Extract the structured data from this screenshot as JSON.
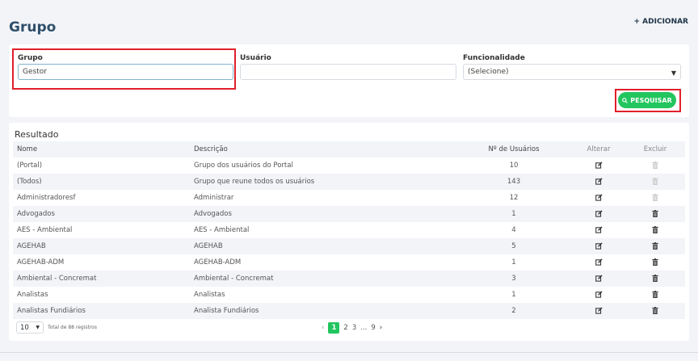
{
  "page": {
    "title": "Grupo",
    "add_label": "+ ADICIONAR"
  },
  "filters": {
    "grupo_label": "Grupo",
    "grupo_value": "Gestor",
    "usuario_label": "Usuário",
    "usuario_value": "",
    "funcionalidade_label": "Funcionalidade",
    "funcionalidade_value": "(Selecione)",
    "search_label": "PESQUISAR"
  },
  "result": {
    "title": "Resultado",
    "headers": {
      "nome": "Nome",
      "descricao": "Descrição",
      "usuarios": "Nº de Usuários",
      "alterar": "Alterar",
      "excluir": "Excluir"
    },
    "rows": [
      {
        "nome": "(Portal)",
        "descricao": "Grupo dos usuários do Portal",
        "usuarios": "10",
        "deletable": false
      },
      {
        "nome": "(Todos)",
        "descricao": "Grupo que reune todos os usuários",
        "usuarios": "143",
        "deletable": false
      },
      {
        "nome": "Administradoresf",
        "descricao": "Administrar",
        "usuarios": "12",
        "deletable": false
      },
      {
        "nome": "Advogados",
        "descricao": "Advogados",
        "usuarios": "1",
        "deletable": true
      },
      {
        "nome": "AES - Ambiental",
        "descricao": "AES - Ambiental",
        "usuarios": "4",
        "deletable": true
      },
      {
        "nome": "AGEHAB",
        "descricao": "AGEHAB",
        "usuarios": "5",
        "deletable": true
      },
      {
        "nome": "AGEHAB-ADM",
        "descricao": "AGEHAB-ADM",
        "usuarios": "1",
        "deletable": true
      },
      {
        "nome": "Ambiental - Concremat",
        "descricao": "Ambiental - Concremat",
        "usuarios": "3",
        "deletable": true
      },
      {
        "nome": "Analistas",
        "descricao": "Analistas",
        "usuarios": "1",
        "deletable": true
      },
      {
        "nome": "Analistas Fundiários",
        "descricao": "Analista Fundiários",
        "usuarios": "2",
        "deletable": true
      }
    ]
  },
  "pager": {
    "page_size": "10",
    "total_text": "Total de 88 registros",
    "pages": [
      "1",
      "2",
      "3",
      "...",
      "9"
    ],
    "active_page": "1"
  },
  "colors": {
    "accent_green": "#22c55e",
    "highlight_red": "#e0202a",
    "title_blue": "#2f4f6a"
  }
}
